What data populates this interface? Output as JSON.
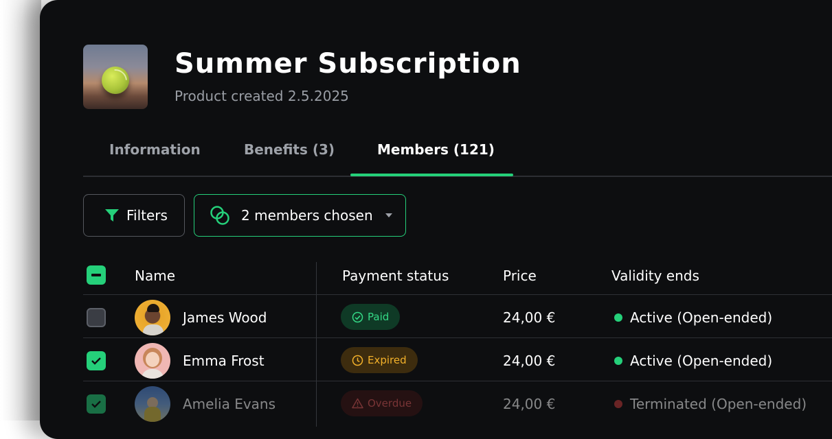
{
  "product": {
    "title": "Summer Subscription",
    "subtitle": "Product created 2.5.2025",
    "image_alt": "tennis ball"
  },
  "tabs": [
    {
      "label": "Information",
      "active": false
    },
    {
      "label": "Benefits (3)",
      "active": false
    },
    {
      "label": "Members (121)",
      "active": true
    }
  ],
  "toolbar": {
    "filters_label": "Filters",
    "members_chosen_label": "2 members chosen"
  },
  "table": {
    "columns": [
      "Name",
      "Payment status",
      "Price",
      "Validity ends"
    ],
    "header_checkbox": "indeterminate",
    "rows": [
      {
        "name": "James Wood",
        "selected": false,
        "payment_status": "Paid",
        "price": "24,00 €",
        "validity": "Active (Open-ended)",
        "validity_state": "active"
      },
      {
        "name": "Emma Frost",
        "selected": true,
        "payment_status": "Expired",
        "price": "24,00 €",
        "validity": "Active (Open-ended)",
        "validity_state": "active"
      },
      {
        "name": "Amelia Evans",
        "selected": true,
        "payment_status": "Overdue",
        "price": "24,00 €",
        "validity": "Terminated (Open-ended)",
        "validity_state": "terminated"
      }
    ]
  },
  "colors": {
    "accent": "#25d07a",
    "background": "#0d0e10",
    "paid_bg": "#0f3a26",
    "paid_fg": "#34d986",
    "expired_bg": "#3d2c0e",
    "expired_fg": "#f3b12a",
    "overdue_bg": "#3e1414",
    "overdue_fg": "#e25b5b",
    "terminated_dot": "#c43b3b"
  },
  "icons": {
    "filters": "funnel-icon",
    "members_chosen": "linked-circles-icon",
    "dropdown": "caret-down-icon",
    "paid": "check-circle-icon",
    "expired": "clock-icon",
    "overdue": "warning-triangle-icon"
  }
}
